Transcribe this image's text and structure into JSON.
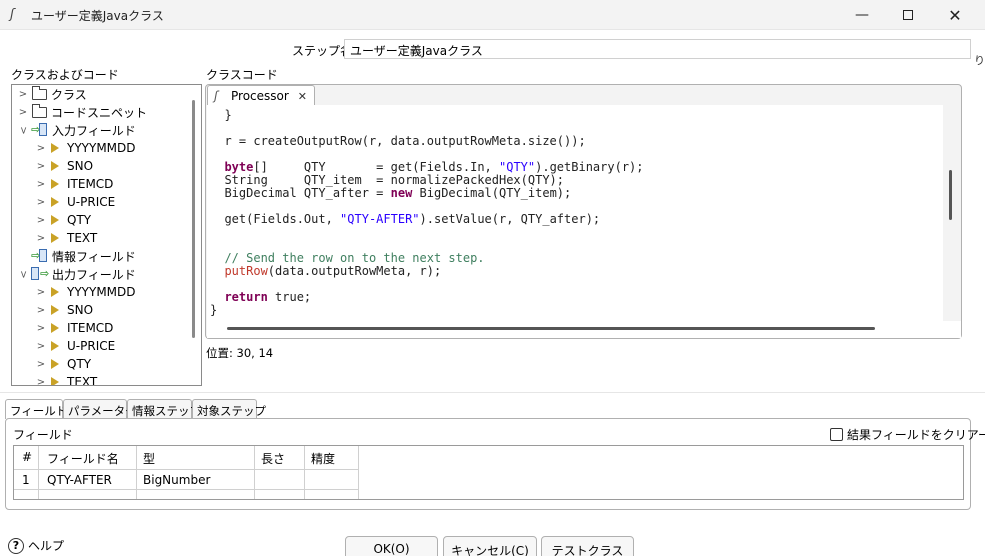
{
  "window": {
    "title": "ユーザー定義Javaクラス",
    "icon": "script-icon",
    "controls": [
      "minimize",
      "maximize",
      "close"
    ]
  },
  "step_name": {
    "label": "ステップ名",
    "value": "ユーザー定義Javaクラス"
  },
  "class_tree": {
    "label": "クラスおよびコード",
    "items": [
      {
        "label": "クラス",
        "icon": "folder-icon",
        "expanded": false
      },
      {
        "label": "コードスニペット",
        "icon": "folder-icon",
        "expanded": false
      },
      {
        "label": "入力フィールド",
        "icon": "input-fields-icon",
        "expanded": true
      },
      {
        "label": "YYYYMMDD",
        "icon": "field-icon"
      },
      {
        "label": "SNO",
        "icon": "field-icon"
      },
      {
        "label": "ITEMCD",
        "icon": "field-icon"
      },
      {
        "label": "U-PRICE",
        "icon": "field-icon"
      },
      {
        "label": "QTY",
        "icon": "field-icon"
      },
      {
        "label": "TEXT",
        "icon": "field-icon"
      },
      {
        "label": "情報フィールド",
        "icon": "info-fields-icon"
      },
      {
        "label": "出力フィールド",
        "icon": "output-fields-icon",
        "expanded": true
      },
      {
        "label": "YYYYMMDD",
        "icon": "field-icon"
      },
      {
        "label": "SNO",
        "icon": "field-icon"
      },
      {
        "label": "ITEMCD",
        "icon": "field-icon"
      },
      {
        "label": "U-PRICE",
        "icon": "field-icon"
      },
      {
        "label": "QTY",
        "icon": "field-icon"
      },
      {
        "label": "TEXT",
        "icon": "field-icon"
      }
    ]
  },
  "class_code": {
    "label": "クラスコード",
    "tab": {
      "label": "Processor",
      "close": "✕"
    },
    "position": "位置: 30, 14",
    "lines": [
      {
        "text": "  }"
      },
      {
        "text": ""
      },
      {
        "text": "  r = createOutputRow(r, data.outputRowMeta.size());"
      },
      {
        "text": ""
      },
      {
        "segments": [
          [
            "kw",
            "  byte"
          ],
          [
            "",
            "[]     QTY       = get(Fields.In, "
          ],
          [
            "str",
            "\"QTY\""
          ],
          [
            "",
            ").getBinary(r);"
          ]
        ]
      },
      {
        "text": "  String     QTY_item  = normalizePackedHex(QTY);"
      },
      {
        "segments": [
          [
            "",
            "  BigDecimal QTY_after = "
          ],
          [
            "kw",
            "new"
          ],
          [
            "",
            " BigDecimal(QTY_item);"
          ]
        ]
      },
      {
        "text": ""
      },
      {
        "segments": [
          [
            "",
            "  get(Fields.Out, "
          ],
          [
            "str",
            "\"QTY-AFTER\""
          ],
          [
            "",
            ").setValue(r, QTY_after);"
          ]
        ]
      },
      {
        "text": ""
      },
      {
        "text": ""
      },
      {
        "segments": [
          [
            "cmt",
            "  // Send the row on to the next step."
          ]
        ]
      },
      {
        "segments": [
          [
            "fn",
            "  putRow"
          ],
          [
            "",
            "(data.outputRowMeta, r);"
          ]
        ]
      },
      {
        "text": ""
      },
      {
        "segments": [
          [
            "kw",
            "  return"
          ],
          [
            "",
            " true;"
          ]
        ]
      },
      {
        "text": "}"
      }
    ]
  },
  "bottom_tabs": [
    "フィールド",
    "パラメーター",
    "情報ステップ",
    "対象ステップ"
  ],
  "fields_panel": {
    "label": "フィールド",
    "clear_checkbox": "結果フィールドをクリアー",
    "columns": [
      "#",
      "フィールド名",
      "型",
      "長さ",
      "精度"
    ],
    "rows": [
      [
        "1",
        "QTY-AFTER",
        "BigNumber",
        "",
        ""
      ]
    ]
  },
  "buttons": {
    "help": "ヘルプ",
    "ok": "OK(O)",
    "cancel": "キャンセル(C)",
    "test": "テストクラス"
  },
  "colors": {
    "keyword": "#7f0055",
    "string": "#2a00ff",
    "comment": "#3f7f5f",
    "function": "#c0392b",
    "field_marker": "#c9a227"
  }
}
